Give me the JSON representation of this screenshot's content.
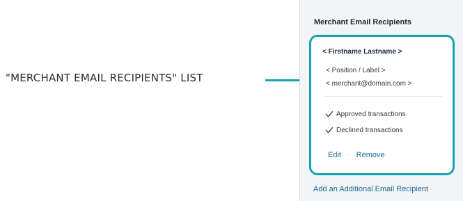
{
  "callout": {
    "label": "\"MERCHANT EMAIL RECIPIENTS\" LIST"
  },
  "panel": {
    "title": "Merchant Email Recipients",
    "recipient": {
      "name": "< Firstname Lastname >",
      "position": "< Position / Label >",
      "email": "< merchant@domain.com >",
      "notifications": [
        {
          "label": "Approved transactions",
          "checked": true,
          "icon": "checkmark-icon"
        },
        {
          "label": "Declined transactions",
          "checked": true,
          "icon": "checkmark-icon"
        }
      ],
      "actions": {
        "edit_label": "Edit",
        "separator": "·",
        "remove_label": "Remove"
      }
    },
    "add_link_label": "Add an Additional Email Recipient"
  },
  "colors": {
    "accent": "#12a3b3",
    "link": "#1a6d96",
    "panel_background": "#f3f4f5",
    "heading": "#1d2b3a"
  }
}
